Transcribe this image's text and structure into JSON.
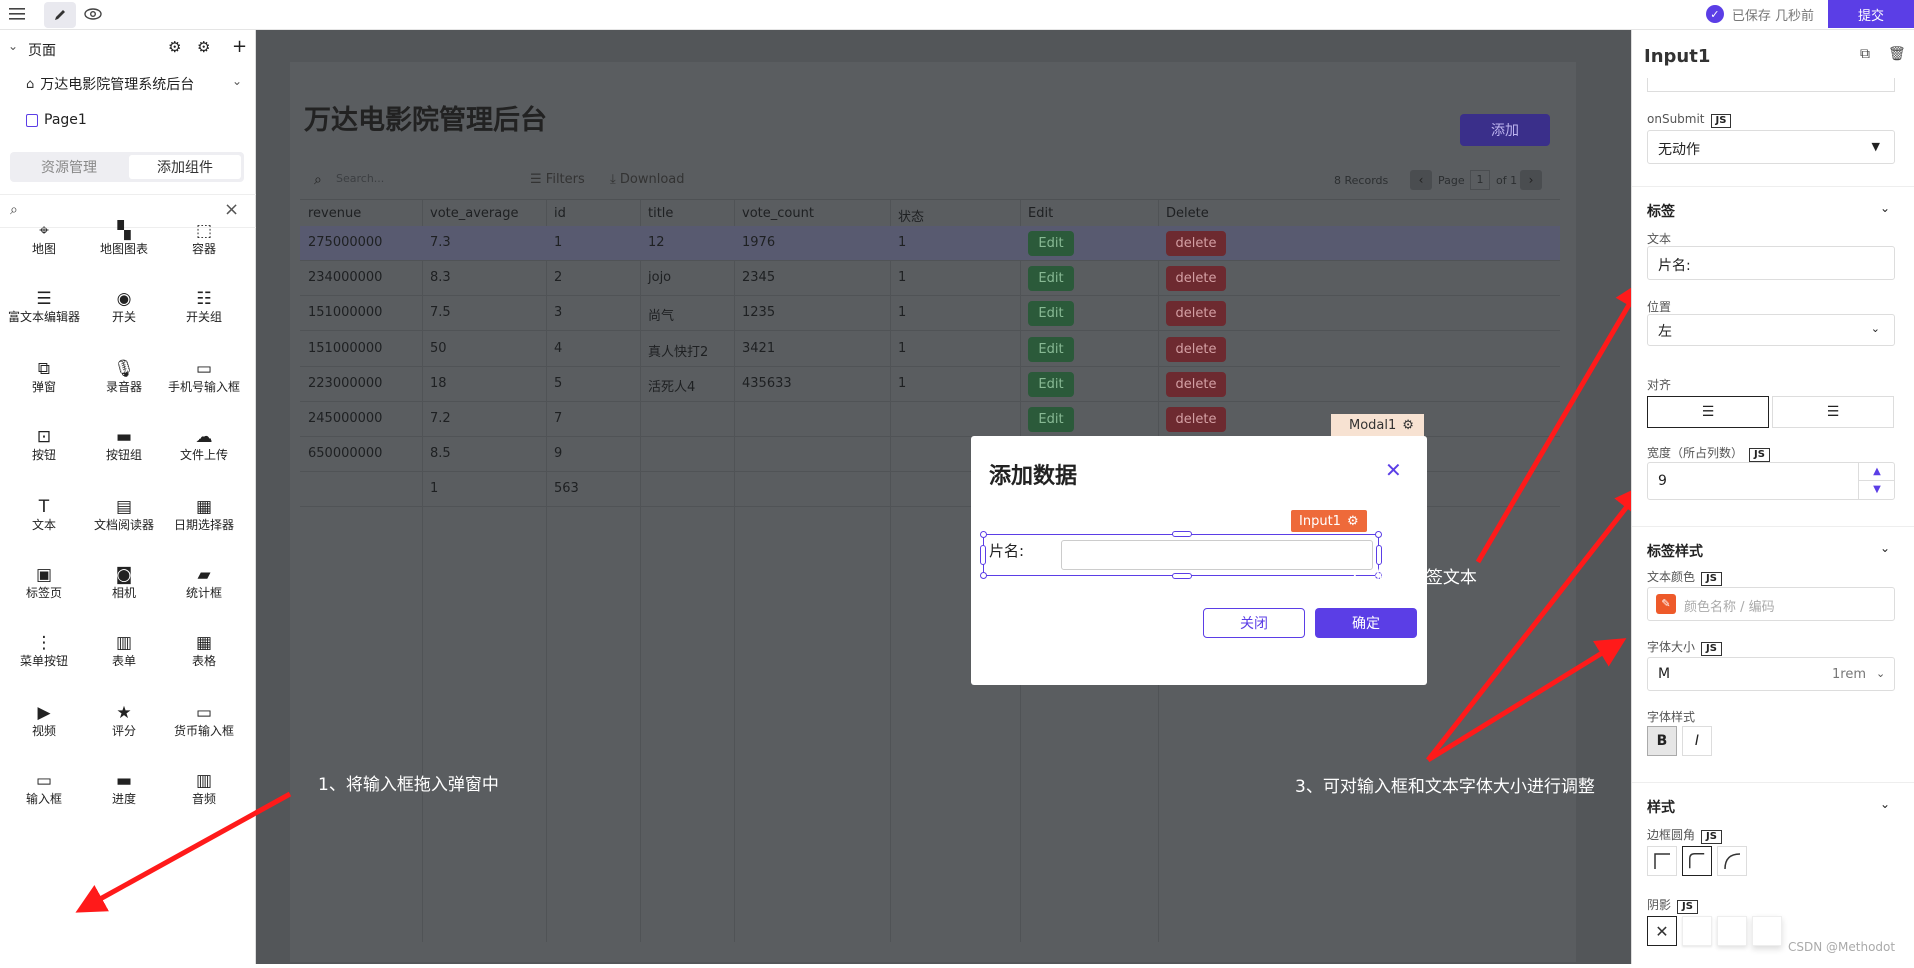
{
  "topbar": {
    "saved_text": "已保存 几秒前",
    "submit_label": "提交"
  },
  "left": {
    "pages_title": "页面",
    "pages": [
      {
        "label": "万达电影院管理系统后台"
      },
      {
        "label": "Page1"
      }
    ],
    "tabs": {
      "resources": "资源管理",
      "add_component": "添加组件"
    },
    "search_value": "",
    "components": [
      {
        "label": "地图",
        "icon": "map-pin-icon"
      },
      {
        "label": "地图图表",
        "icon": "map-chart-icon"
      },
      {
        "label": "容器",
        "icon": "container-icon"
      },
      {
        "label": "富文本编辑器",
        "icon": "rich-text-icon"
      },
      {
        "label": "开关",
        "icon": "toggle-icon"
      },
      {
        "label": "开关组",
        "icon": "toggle-group-icon"
      },
      {
        "label": "弹窗",
        "icon": "modal-icon"
      },
      {
        "label": "录音器",
        "icon": "microphone-icon"
      },
      {
        "label": "手机号输入框",
        "icon": "phone-input-icon"
      },
      {
        "label": "按钮",
        "icon": "button-icon"
      },
      {
        "label": "按钮组",
        "icon": "button-group-icon"
      },
      {
        "label": "文件上传",
        "icon": "upload-icon"
      },
      {
        "label": "文本",
        "icon": "text-icon"
      },
      {
        "label": "文档阅读器",
        "icon": "pdf-icon"
      },
      {
        "label": "日期选择器",
        "icon": "calendar-icon"
      },
      {
        "label": "标签页",
        "icon": "tabs-icon"
      },
      {
        "label": "相机",
        "icon": "camera-icon"
      },
      {
        "label": "统计框",
        "icon": "stat-icon"
      },
      {
        "label": "菜单按钮",
        "icon": "menu-button-icon"
      },
      {
        "label": "表单",
        "icon": "form-icon"
      },
      {
        "label": "表格",
        "icon": "table-icon"
      },
      {
        "label": "视频",
        "icon": "video-icon"
      },
      {
        "label": "评分",
        "icon": "star-icon"
      },
      {
        "label": "货币输入框",
        "icon": "currency-input-icon"
      },
      {
        "label": "输入框",
        "icon": "input-icon"
      },
      {
        "label": "进度",
        "icon": "progress-icon"
      },
      {
        "label": "音频",
        "icon": "audio-icon"
      }
    ]
  },
  "canvas": {
    "app_title": "万达电影院管理后台",
    "add_button": "添加",
    "table": {
      "search_placeholder": "Search...",
      "filters": "Filters",
      "download": "Download",
      "records": "8 Records",
      "page_label": "Page",
      "page_num": "1",
      "page_of": "of 1",
      "columns": [
        "revenue",
        "vote_average",
        "id",
        "title",
        "vote_count",
        "状态",
        "Edit",
        "Delete"
      ],
      "rows": [
        [
          "275000000",
          "7.3",
          "1",
          "12",
          "1976",
          "1"
        ],
        [
          "234000000",
          "8.3",
          "2",
          "jojo",
          "2345",
          "1"
        ],
        [
          "151000000",
          "7.5",
          "3",
          "尚气",
          "1235",
          "1"
        ],
        [
          "151000000",
          "50",
          "4",
          "真人快打2",
          "3421",
          "1"
        ],
        [
          "223000000",
          "18",
          "5",
          "活死人4",
          "435633",
          "1"
        ],
        [
          "245000000",
          "7.2",
          "7",
          "",
          "",
          ""
        ],
        [
          "650000000",
          "8.5",
          "9",
          "",
          "",
          ""
        ],
        [
          "",
          "1",
          "563",
          "",
          "",
          ""
        ]
      ],
      "edit_label": "Edit",
      "delete_label": "delete"
    },
    "modal_tag": "Modal1",
    "modal": {
      "title": "添加数据",
      "input_tag": "Input1",
      "input_label": "片名:",
      "cancel": "关闭",
      "ok": "确定"
    }
  },
  "annotations": {
    "step1": "1、将输入框拖入弹窗中",
    "step2": "2、修改标签文本",
    "step3": "3、可对输入框和文本字体大小进行调整"
  },
  "right": {
    "title": "Input1",
    "on_submit_label": "onSubmit",
    "js": "JS",
    "on_submit_value": "无动作",
    "label_section": "标签",
    "text_label": "文本",
    "text_value": "片名:",
    "position_label": "位置",
    "position_value": "左",
    "align_label": "对齐",
    "width_label": "宽度（所占列数）",
    "width_value": "9",
    "label_style_section": "标签样式",
    "text_color_label": "文本颜色",
    "text_color_placeholder": "颜色名称 / 编码",
    "font_size_label": "字体大小",
    "font_size_value": "M",
    "font_size_unit": "1rem",
    "font_style_label": "字体样式",
    "font_bold": "B",
    "font_italic": "I",
    "style_section": "样式",
    "border_radius_label": "边框圆角",
    "shadow_label": "阴影"
  },
  "watermark": "CSDN @Methodot",
  "colors": {
    "accent": "#5b3ee6",
    "annotation_arrow": "#ff1a1a",
    "input_tag": "#ee6a3a"
  }
}
